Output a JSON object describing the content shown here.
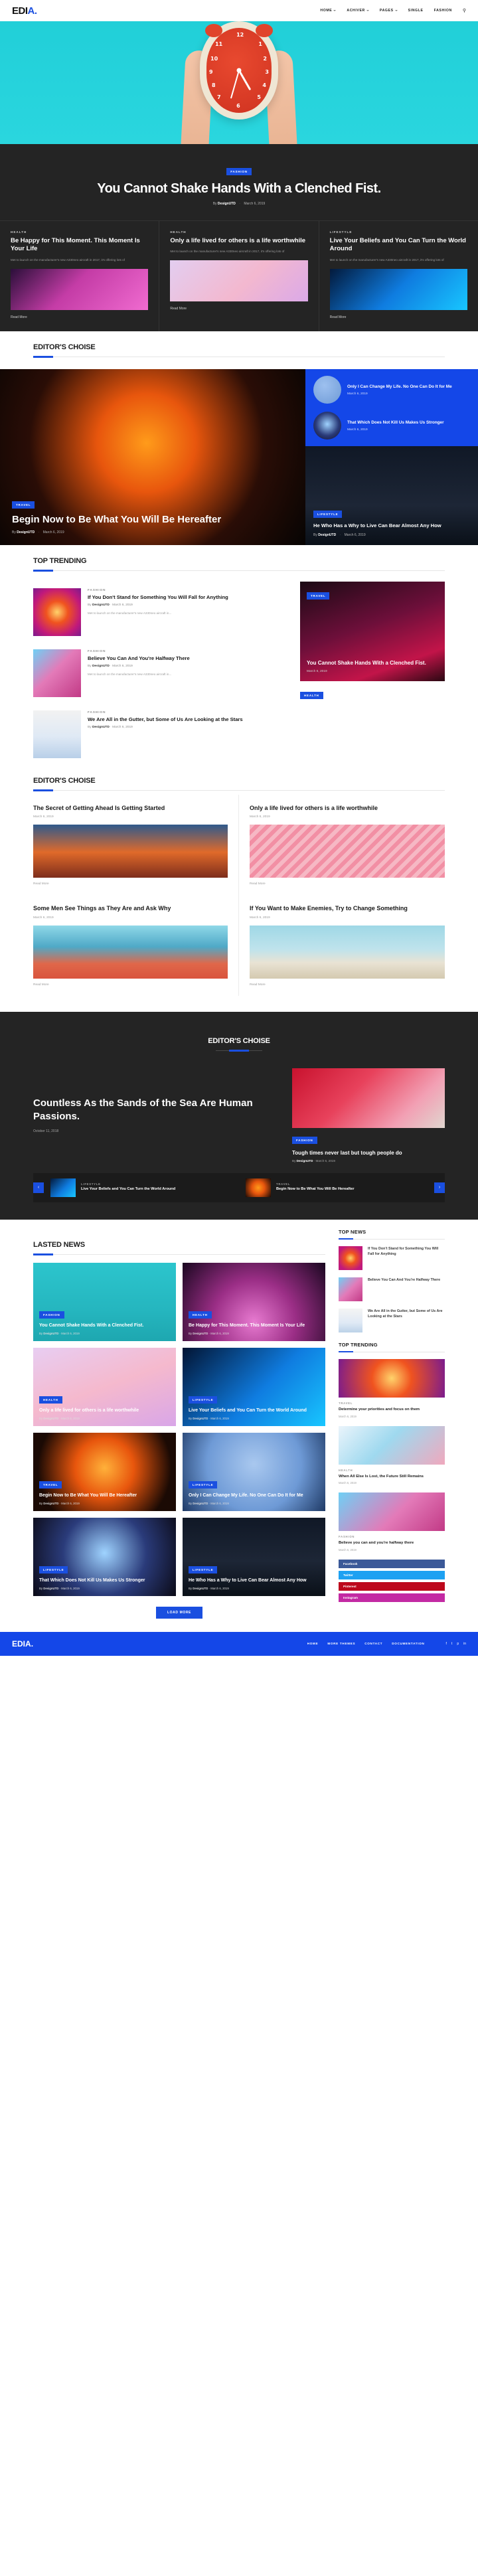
{
  "site": {
    "logo_edi": "EDI",
    "logo_a": "A",
    "logo_dot": "."
  },
  "nav": {
    "items": [
      {
        "label": "HOME",
        "caret": true
      },
      {
        "label": "ACHIVER",
        "caret": true
      },
      {
        "label": "PAGES",
        "caret": true
      },
      {
        "label": "SINGLE",
        "caret": false
      },
      {
        "label": "FASHION",
        "caret": false
      }
    ],
    "search_icon": "search-icon"
  },
  "hero": {
    "badge": "FASHION",
    "title": "You Cannot Shake Hands With a Clenched Fist.",
    "by_prefix": "By",
    "author": "DesignUTD",
    "sep": "·",
    "date": "March 6, 2019"
  },
  "feature_cards": [
    {
      "category": "HEALTH",
      "title": "Be Happy for This Moment. This Moment Is Your Life",
      "excerpt": "Met to launch on the manufacturer's new A330neo aircraft in 2017, it's offering lots of",
      "read_more": "Read More"
    },
    {
      "category": "HEALTH",
      "title": "Only a life lived for others is a life worthwhile",
      "excerpt": "Met to launch on the manufacturer's new A330neo aircraft in 2017, it's offering lots of",
      "read_more": "Read More"
    },
    {
      "category": "LIFESTYLE",
      "title": "Live Your Beliefs and You Can Turn the World Around",
      "excerpt": "Met to launch on the manufacturer's new A330neo aircraft in 2017, it's offering lots of",
      "read_more": "Read More"
    }
  ],
  "editors_choice_1": {
    "section_title": "EDITOR'S CHOISE",
    "main": {
      "badge": "TRAVEL",
      "title": "Begin Now to Be What You Will Be Hereafter",
      "by_prefix": "By",
      "author": "DesignUTD",
      "sep": "·",
      "date": "March 6, 2019"
    },
    "side_items": [
      {
        "title": "Only I Can Change My Life. No One Can Do It for Me",
        "date": "March 6, 2019"
      },
      {
        "title": "That Which Does Not Kill Us Makes Us Stronger",
        "date": "March 6, 2019"
      }
    ],
    "side_bottom": {
      "badge": "LIFESTYLE",
      "title": "He Who Has a Why to Live Can Bear Almost Any How",
      "by_prefix": "By",
      "author": "DesignUTD",
      "sep": "·",
      "date": "March 6, 2019"
    }
  },
  "top_trending": {
    "section_title": "TOP TRENDING",
    "rows": [
      {
        "category": "FASHION",
        "title": "If You Don't Stand for Something You Will Fall for Anything",
        "by_prefix": "By",
        "author": "DesignUTD",
        "sep": "·",
        "date": "March 6, 2019",
        "excerpt": "Met to launch on the manufacturer's new A330neo aircraft in..."
      },
      {
        "category": "FASHION",
        "title": "Believe You Can And You're Halfway There",
        "by_prefix": "By",
        "author": "DesignUTD",
        "sep": "·",
        "date": "March 6, 2019",
        "excerpt": "Met to launch on the manufacturer's new A330neo aircraft in..."
      },
      {
        "category": "FASHION",
        "title": "We Are All in the Gutter, but Some of Us Are Looking at the Stars",
        "by_prefix": "By",
        "author": "DesignUTD",
        "sep": "·",
        "date": "March 6, 2019",
        "excerpt": "Met to launch on the manufacturer's new A330neo aircraft in..."
      }
    ],
    "feature_card": {
      "badge": "TRAVEL",
      "title": "You Cannot Shake Hands With a Clenched Fist.",
      "date": "March 6, 2019",
      "below_badge": "HEALTH"
    }
  },
  "editors_choice_2": {
    "section_title": "EDITOR'S CHOISE",
    "cells": [
      {
        "title": "The Secret of Getting Ahead Is Getting Started",
        "date": "March 6, 2019",
        "read_more": "Read More"
      },
      {
        "title": "Only a life lived for others is a life worthwhile",
        "date": "March 6, 2019",
        "read_more": "Read More"
      },
      {
        "title": "Some Men See Things as They Are and Ask Why",
        "date": "March 6, 2019",
        "read_more": "Read More"
      },
      {
        "title": "If You Want to Make Enemies, Try to Change Something",
        "date": "March 6, 2019",
        "read_more": "Read More"
      }
    ]
  },
  "dark_quote": {
    "section_title": "EDITOR'S CHOISE",
    "title": "Countless As the Sands of the Sea Are Human Passions.",
    "date": "October 11, 2018",
    "side_badge": "FASHION",
    "side_title": "Tough times never last but tough people do",
    "side_by_prefix": "By",
    "side_author": "DesignUTD",
    "side_sep": "·",
    "side_date": "March 6, 2019"
  },
  "strip": {
    "prev": "‹",
    "next": "›",
    "items": [
      {
        "category": "LIFESTYLE",
        "title": "Live Your Beliefs and You Can Turn the World Around"
      },
      {
        "category": "TRAVEL",
        "title": "Begin Now to Be What You Will Be Hereafter"
      }
    ]
  },
  "lasted_news": {
    "section_title": "LASTED NEWS",
    "cards": [
      {
        "badge": "FASHION",
        "title": "You Cannot Shake Hands With a Clenched Fist.",
        "by_prefix": "By",
        "author": "DesignUTD",
        "sep": "·",
        "date": "March 6, 2019"
      },
      {
        "badge": "HEALTH",
        "title": "Be Happy for This Moment. This Moment Is Your Life",
        "by_prefix": "By",
        "author": "DesignUTD",
        "sep": "·",
        "date": "March 6, 2019"
      },
      {
        "badge": "HEALTH",
        "title": "Only a life lived for others is a life worthwhile",
        "by_prefix": "By",
        "author": "DesignUTD",
        "sep": "·",
        "date": "March 6, 2019"
      },
      {
        "badge": "LIFESTYLE",
        "title": "Live Your Beliefs and You Can Turn the World Around",
        "by_prefix": "By",
        "author": "DesignUTD",
        "sep": "·",
        "date": "March 6, 2019"
      },
      {
        "badge": "TRAVEL",
        "title": "Begin Now to Be What You Will Be Hereafter",
        "by_prefix": "By",
        "author": "DesignUTD",
        "sep": "·",
        "date": "March 6, 2019"
      },
      {
        "badge": "LIFESTYLE",
        "title": "Only I Can Change My Life. No One Can Do It for Me",
        "by_prefix": "By",
        "author": "DesignUTD",
        "sep": "·",
        "date": "March 6, 2019"
      },
      {
        "badge": "LIFESTYLE",
        "title": "That Which Does Not Kill Us Makes Us Stronger",
        "by_prefix": "By",
        "author": "DesignUTD",
        "sep": "·",
        "date": "March 6, 2019"
      },
      {
        "badge": "LIFESTYLE",
        "title": "He Who Has a Why to Live Can Bear Almost Any How",
        "by_prefix": "By",
        "author": "DesignUTD",
        "sep": "·",
        "date": "March 6, 2019"
      }
    ],
    "load_more": "LOAD MORE"
  },
  "sidebar": {
    "top_news_title": "TOP NEWS",
    "top_news": [
      {
        "title": "If You Don't Stand for Something You Will Fall for Anything"
      },
      {
        "title": "Believe You Can And You're Halfway There"
      },
      {
        "title": "We Are All in the Gutter, but Some of Us Are Looking at the Stars"
      }
    ],
    "top_trending_title": "TOP TRENDING",
    "trending_cards": [
      {
        "category": "TRAVEL",
        "title": "Determine your priorities and focus on them",
        "date": "March 6, 2019"
      },
      {
        "category": "HEALTH",
        "title": "When All Else Is Lost, the Future Still Remains",
        "date": "March 6, 2019"
      },
      {
        "category": "FASHION",
        "title": "Believe you can and you're halfway there",
        "date": "March 6, 2019"
      }
    ],
    "socials": [
      {
        "label": "Facebook",
        "count": "",
        "color": "#3b5998"
      },
      {
        "label": "Twitter",
        "count": "",
        "color": "#1da1f2"
      },
      {
        "label": "Pinterest",
        "count": "",
        "color": "#bd081c"
      },
      {
        "label": "Instagram",
        "count": "",
        "color": "#c32aa3"
      }
    ]
  },
  "footer": {
    "logo_edi": "EDI",
    "logo_a": "A",
    "logo_dot": ".",
    "links": [
      {
        "label": "HOME"
      },
      {
        "label": "MORE THEMES"
      },
      {
        "label": "CONTACT"
      },
      {
        "label": "DOCUMENTATION"
      }
    ],
    "socials": [
      "f",
      "t",
      "p",
      "in"
    ]
  }
}
